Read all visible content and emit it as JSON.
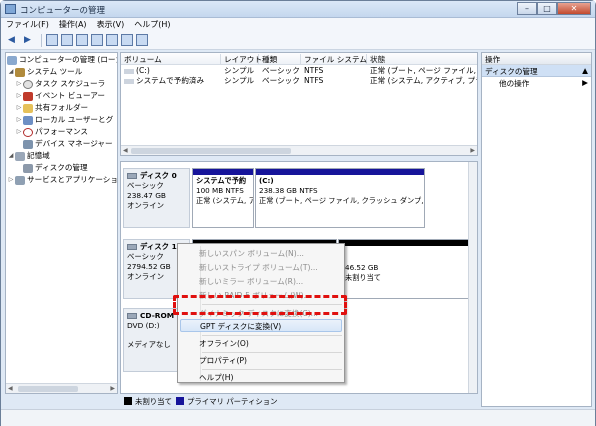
{
  "window": {
    "title": "コンピューターの管理",
    "min": "–",
    "max": "□",
    "close": "✕"
  },
  "menu": [
    "ファイル(F)",
    "操作(A)",
    "表示(V)",
    "ヘルプ(H)"
  ],
  "tree": {
    "root": "コンピューターの管理 (ローカ",
    "system_tools": "システム ツール",
    "task_scheduler": "タスク スケジューラ",
    "event_viewer": "イベント ビューアー",
    "shared_folders": "共有フォルダー",
    "local_users": "ローカル ユーザーとグ",
    "performance": "パフォーマンス",
    "device_manager": "デバイス マネージャー",
    "storage": "記憶域",
    "disk_management": "ディスクの管理",
    "services": "サービスとアプリケーショ"
  },
  "volume_list": {
    "headers": [
      "ボリューム",
      "レイアウト",
      "種類",
      "ファイル システム",
      "状態"
    ],
    "rows": [
      [
        "(C:)",
        "シンプル",
        "ベーシック",
        "NTFS",
        "正常 (ブート, ページ ファイル, ク"
      ],
      [
        "システムで予約済み",
        "シンプル",
        "ベーシック",
        "NTFS",
        "正常 (システム, アクティブ, プラ"
      ]
    ]
  },
  "disk0": {
    "name": "ディスク 0",
    "type": "ベーシック",
    "size": "238.47 GB",
    "status": "オンライン",
    "p1": {
      "label": "システムで予約",
      "size": "100 MB NTFS",
      "status": "正常 (システム, ア"
    },
    "p2": {
      "label": "(C:)",
      "size": "238.38 GB NTFS",
      "status": "正常 (ブート, ページ ファイル, クラッシュ ダンプ,"
    }
  },
  "disk1": {
    "name": "ディスク 1",
    "type": "ベーシック",
    "size": "2794.52 GB",
    "status": "オンライン",
    "p_size": "46.52 GB",
    "p_status": "未割り当て"
  },
  "cdrom": {
    "name": "CD-ROM",
    "drive": "DVD (D:)",
    "status": "メディアなし"
  },
  "legend": {
    "unallocated": "未割り当て",
    "primary": "プライマリ パーティション"
  },
  "actions": {
    "header": "操作",
    "selected": "ディスクの管理",
    "more": "他の操作"
  },
  "context_menu": {
    "items": [
      "新しいスパン ボリューム(N)...",
      "新しいストライプ ボリューム(T)...",
      "新しいミラー ボリューム(R)...",
      "新しい RAID-5 ボリューム(W)...",
      "ダイナミック ディスクに変換(C)...",
      "GPT ディスクに変換(V)",
      "オフライン(O)",
      "プロパティ(P)",
      "ヘルプ(H)"
    ]
  },
  "colors": {
    "unallocated": "#000000",
    "primary": "#16149a",
    "highlight": "#e0100e"
  }
}
